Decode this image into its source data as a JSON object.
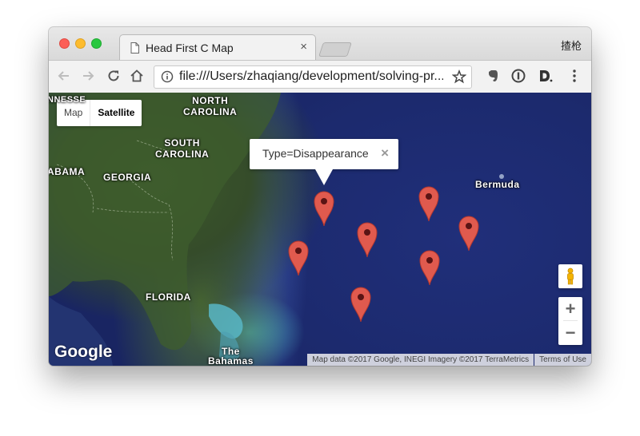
{
  "browser": {
    "tab_title": "Head First C Map",
    "tab_close": "×",
    "profile_name": "揸枪",
    "url": "file:///Users/zhaqiang/development/solving-pr..."
  },
  "map": {
    "map_type": {
      "map_label": "Map",
      "satellite_label": "Satellite",
      "selected": "Satellite"
    },
    "labels": {
      "north_carolina": "NORTH\nCAROLINA",
      "south_carolina": "SOUTH\nCAROLINA",
      "alabama": "ABAMA",
      "georgia": "GEORGIA",
      "florida": "FLORIDA",
      "bermuda": "Bermuda",
      "bahamas": "The\nBahamas",
      "partial_top_left": "NNESSE"
    },
    "info_window": {
      "text": "Type=Disappearance",
      "close": "×"
    },
    "marker_color": "#e05a4e",
    "markers_count": 7,
    "zoom_in": "+",
    "zoom_out": "−",
    "logo": "Google",
    "attribution": "Map data ©2017 Google, INEGI Imagery ©2017 TerraMetrics",
    "terms": "Terms of Use"
  }
}
